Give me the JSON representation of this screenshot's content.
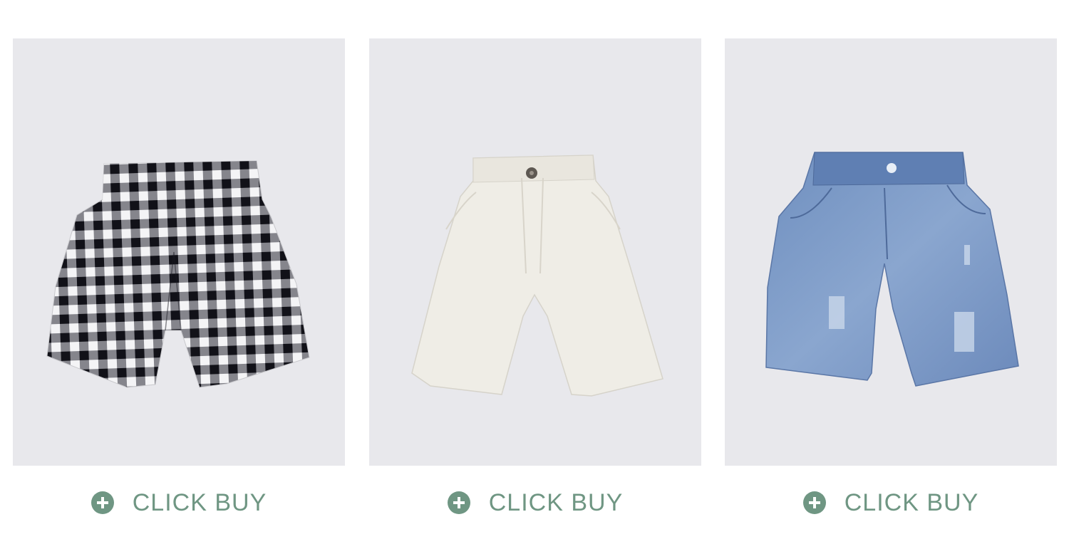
{
  "colors": {
    "accent": "#6f9683",
    "photo_background": "#e8e8ec",
    "page_background": "#ffffff"
  },
  "products": [
    {
      "image": "plaid-shorts-image",
      "buy_label": "CLICK BUY",
      "buy_icon": "plus-circle-icon"
    },
    {
      "image": "beige-chino-shorts-image",
      "buy_label": "CLICK BUY",
      "buy_icon": "plus-circle-icon"
    },
    {
      "image": "denim-shorts-image",
      "buy_label": "CLICK BUY",
      "buy_icon": "plus-circle-icon"
    }
  ]
}
